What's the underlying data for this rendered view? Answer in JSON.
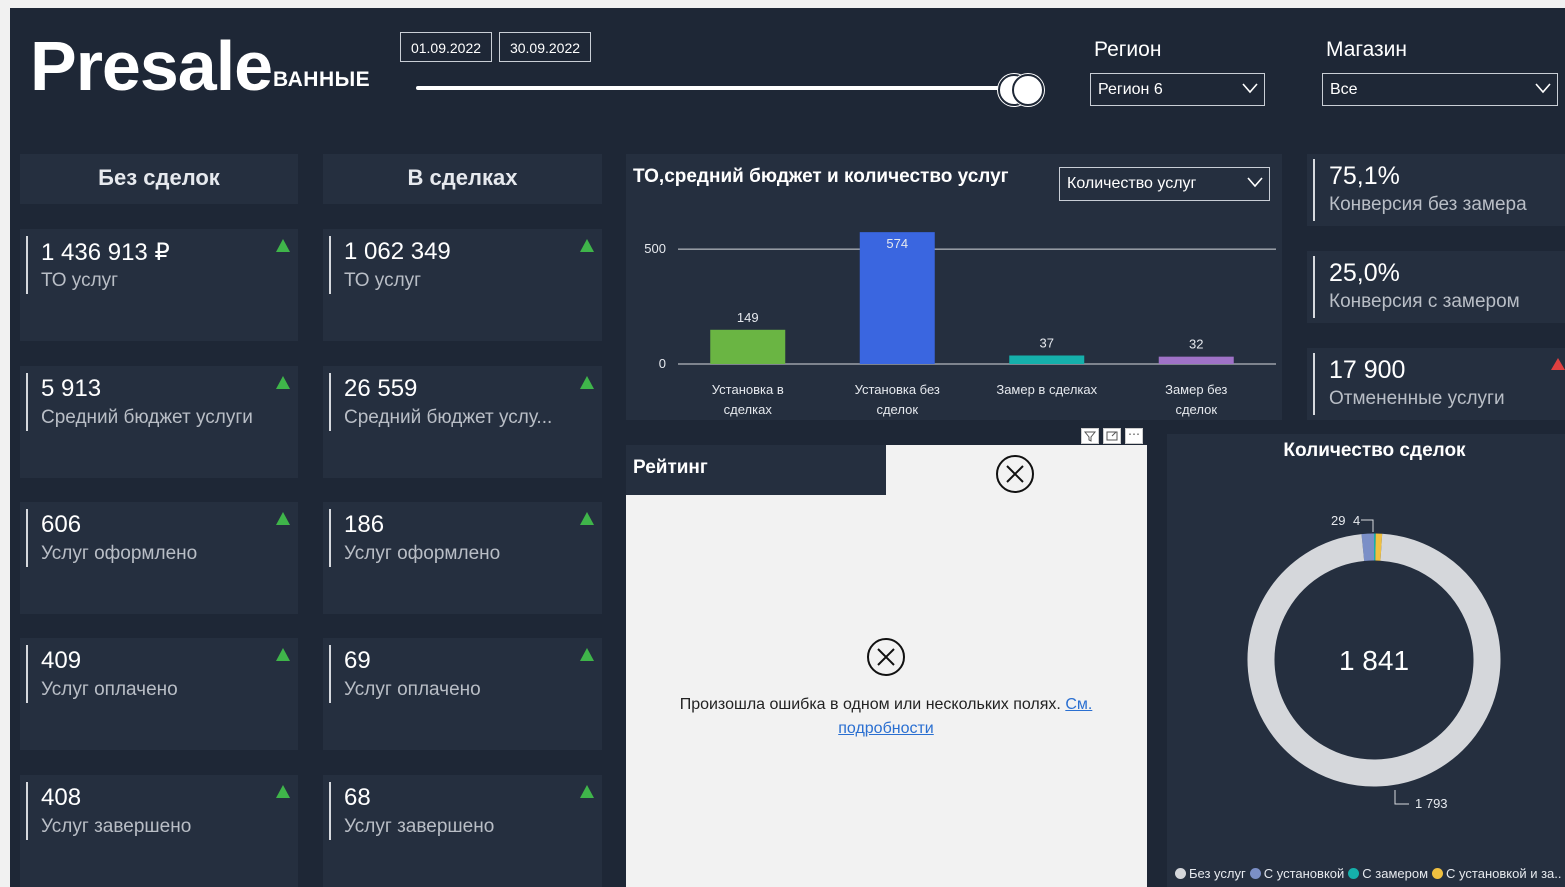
{
  "header": {
    "title": "Presale",
    "subtitle": "ВАННЫЕ",
    "date_start": "01.09.2022",
    "date_end": "30.09.2022",
    "region_label": "Регион",
    "region_value": "Регион 6",
    "store_label": "Магазин",
    "store_value": "Все"
  },
  "columns": {
    "left_title": "Без сделок",
    "right_title": "В сделках"
  },
  "cards_left": [
    {
      "value": "1 436 913 ₽",
      "label": "ТО услуг"
    },
    {
      "value": "5 913",
      "label": "Средний бюджет услуги"
    },
    {
      "value": "606",
      "label": "Услуг оформлено"
    },
    {
      "value": "409",
      "label": "Услуг оплачено"
    },
    {
      "value": "408",
      "label": "Услуг завершено"
    }
  ],
  "cards_right": [
    {
      "value": "1 062 349",
      "label": "ТО услуг"
    },
    {
      "value": "26 559",
      "label": "Средний бюджет услу..."
    },
    {
      "value": "186",
      "label": "Услуг оформлено"
    },
    {
      "value": "69",
      "label": "Услуг оплачено"
    },
    {
      "value": "68",
      "label": "Услуг завершено"
    }
  ],
  "bar_panel": {
    "title": "ТО,средний бюджет и количество услуг",
    "dropdown_value": "Количество услуг"
  },
  "kpis": [
    {
      "value": "75,1%",
      "label": "Конверсия без замера"
    },
    {
      "value": "25,0%",
      "label": "Конверсия с замером"
    },
    {
      "value": "17 900",
      "label": "Отмененные услуги"
    }
  ],
  "rating": {
    "title": "Рейтинг",
    "error_text": "Произошла ошибка в одном или нескольких полях.",
    "error_link_1": "См.",
    "error_link_2": "подробности"
  },
  "donut_panel": {
    "title": "Количество сделок",
    "center_value": "1 841",
    "label_top_1": "29",
    "label_top_2": "4",
    "label_bottom": "1 793"
  },
  "colors": {
    "background": "#1e2736",
    "panel": "#252f3f",
    "up_arrow": "#3fb54a",
    "down_arrow": "#e04040"
  },
  "chart_data": [
    {
      "type": "bar",
      "title": "ТО,средний бюджет и количество услуг",
      "categories": [
        "Установка в сделках",
        "Установка без сделок",
        "Замер в сделках",
        "Замер без сделок"
      ],
      "category_lines": [
        [
          "Установка в",
          "сделках"
        ],
        [
          "Установка без",
          "сделок"
        ],
        [
          "Замер в сделках"
        ],
        [
          "Замер без",
          "сделок"
        ]
      ],
      "values": [
        149,
        574,
        37,
        32
      ],
      "colors": [
        "#6ab543",
        "#3a66e0",
        "#15b0ab",
        "#9f72c7"
      ],
      "yticks": [
        0,
        500
      ],
      "ylim": [
        0,
        574
      ],
      "grid": true
    },
    {
      "type": "pie",
      "title": "Количество сделок",
      "labels": [
        "Без услуг",
        "С установкой",
        "С замером",
        "С установкой и за.."
      ],
      "values": [
        1793,
        29,
        4,
        15
      ],
      "colors": [
        "#d5d7db",
        "#7b8fc7",
        "#15b0ab",
        "#f0c040"
      ]
    }
  ]
}
